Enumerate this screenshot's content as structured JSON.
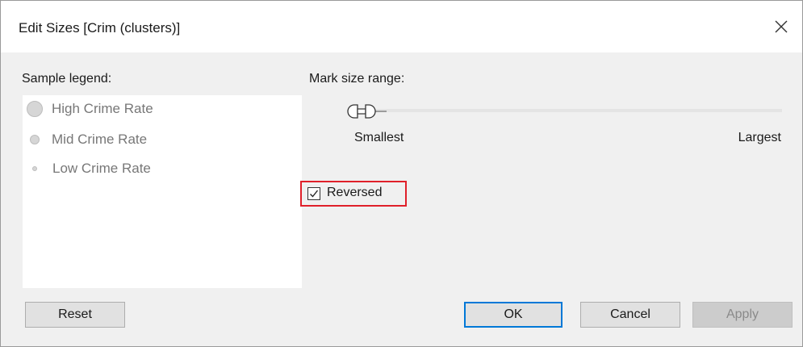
{
  "dialog": {
    "title": "Edit Sizes [Crim (clusters)]",
    "close_icon": "close-icon"
  },
  "legend": {
    "label": "Sample legend:",
    "items": [
      {
        "label": "High Crime Rate",
        "size": "large"
      },
      {
        "label": "Mid Crime Rate",
        "size": "medium"
      },
      {
        "label": "Low Crime Rate",
        "size": "small"
      }
    ]
  },
  "mark_size": {
    "label": "Mark size range:",
    "smallest_label": "Smallest",
    "largest_label": "Largest"
  },
  "reversed": {
    "label": "Reversed",
    "checked": true,
    "highlight_color": "#e0202a"
  },
  "buttons": {
    "reset": "Reset",
    "ok": "OK",
    "cancel": "Cancel",
    "apply": "Apply"
  },
  "colors": {
    "accent": "#0078d7"
  }
}
